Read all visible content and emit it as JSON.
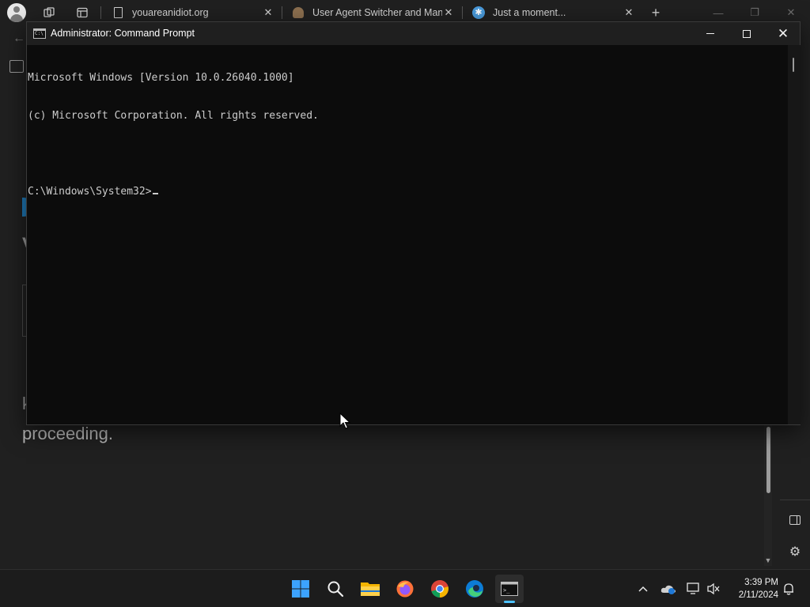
{
  "browser": {
    "tabs": [
      {
        "title": "youareanidiot.org",
        "favicon": "document-icon",
        "active": false
      },
      {
        "title": "User Agent Switcher and Mana",
        "favicon": "agent-icon",
        "active": false
      },
      {
        "title": "Just a moment...",
        "favicon": "cloudflare-icon",
        "active": true
      }
    ],
    "page": {
      "heading_fragment": "V",
      "text_fragment": "k",
      "text": "proceeding."
    }
  },
  "cmd": {
    "title": "Administrator: Command Prompt",
    "lines": [
      "Microsoft Windows [Version 10.0.26040.1000]",
      "(c) Microsoft Corporation. All rights reserved.",
      "",
      "C:\\Windows\\System32>"
    ]
  },
  "taskbar": {
    "apps": [
      "start-icon",
      "search-icon",
      "file-explorer-icon",
      "firefox-icon",
      "chrome-icon",
      "edge-icon",
      "cmd-icon"
    ],
    "clock": {
      "time": "3:39 PM",
      "date": "2/11/2024"
    }
  },
  "colors": {
    "console_bg": "#0c0c0c",
    "console_text": "#cccccc",
    "accent": "#4cc2ff",
    "taskbar": "#1c1c1c"
  }
}
